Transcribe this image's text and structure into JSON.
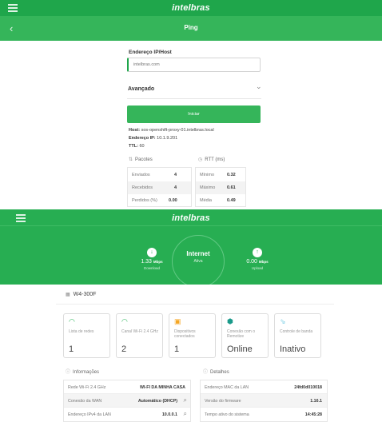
{
  "ping_screen": {
    "brand": "intelbras",
    "back_icon": "‹",
    "title": "Ping",
    "host_label": "Endereço IP/Host",
    "host_value": "intelbras.com",
    "advanced_label": "Avançado",
    "start_button": "Iniciar",
    "host_line_label": "Host:",
    "host_line_value": "sos-openshift-proxy-01.intelbras.local",
    "ip_line_label": "Endereço IP:",
    "ip_line_value": "10.1.9.201",
    "ttl_label": "TTL:",
    "ttl_value": "60",
    "packets_header": "Pacotes",
    "rtt_header": "RTT (ms)",
    "packets": [
      {
        "label": "Enviados",
        "value": "4"
      },
      {
        "label": "Recebidos",
        "value": "4"
      },
      {
        "label": "Perdidos (%)",
        "value": "0.00"
      }
    ],
    "rtt": [
      {
        "label": "Mínimo",
        "value": "0.32"
      },
      {
        "label": "Máximo",
        "value": "0.61"
      },
      {
        "label": "Média",
        "value": "0.49"
      }
    ]
  },
  "dashboard": {
    "brand": "intelbras",
    "internet_title": "Internet",
    "internet_status": "Ativa",
    "download_value": "1.33",
    "download_unit": "Mbps",
    "download_label": "Download",
    "upload_value": "0.00",
    "upload_unit": "Mbps",
    "upload_label": "Upload",
    "device_name": "W4-300F",
    "cards": [
      {
        "label": "Lista de redes",
        "value": "1"
      },
      {
        "label": "Canal Wi-Fi 2.4 GHz",
        "value": "2"
      },
      {
        "label": "Dispositivos conectados",
        "value": "1"
      },
      {
        "label": "Conexão com o Remotize",
        "value": "Online"
      },
      {
        "label": "Controle de banda",
        "value": "Inativo"
      }
    ],
    "info_header": "Informações",
    "details_header": "Detalhes",
    "info_rows": [
      {
        "label": "Rede Wi-Fi 2.4 GHz",
        "value": "WI-FI DA MINHA CASA"
      },
      {
        "label": "Conexão da WAN",
        "value": "Automático (DHCP)"
      },
      {
        "label": "Endereço IPv4 da LAN",
        "value": "10.0.0.1"
      }
    ],
    "detail_rows": [
      {
        "label": "Endereço MAC da LAN",
        "value": "24fd0d010018"
      },
      {
        "label": "Versão do firmware",
        "value": "1.16.1"
      },
      {
        "label": "Tempo ativo do sistema",
        "value": "14:45:28"
      }
    ]
  },
  "colors": {
    "brand_green": "#1fa64b",
    "button_green": "#35b55a",
    "hero_green": "#27ae52",
    "remotize_teal": "#1a9a8a",
    "warning_orange": "#f5a623",
    "wifi_green": "#2bb55b"
  }
}
